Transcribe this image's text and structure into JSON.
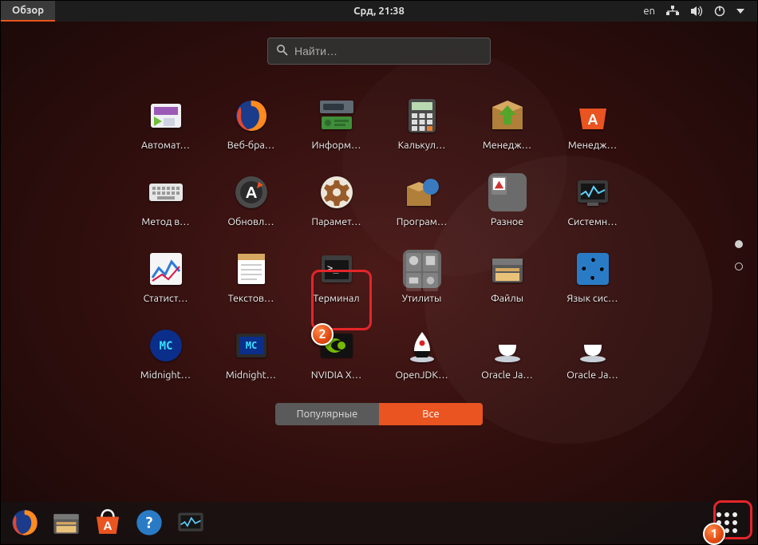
{
  "topbar": {
    "overview_label": "Обзор",
    "datetime": "Срд, 21:38",
    "lang": "en"
  },
  "search": {
    "placeholder": "Найти…"
  },
  "apps": [
    {
      "id": "automat",
      "label": "Автомат…"
    },
    {
      "id": "firefox",
      "label": "Веб-бра…"
    },
    {
      "id": "inform",
      "label": "Информ…"
    },
    {
      "id": "calc",
      "label": "Калькул…"
    },
    {
      "id": "mgr1",
      "label": "Менедж…"
    },
    {
      "id": "mgr2",
      "label": "Менедж…"
    },
    {
      "id": "input",
      "label": "Метод в…"
    },
    {
      "id": "updates",
      "label": "Обновл…"
    },
    {
      "id": "settings",
      "label": "Парамет…"
    },
    {
      "id": "programs",
      "label": "Програм…"
    },
    {
      "id": "misc",
      "label": "Разное",
      "folder": true
    },
    {
      "id": "sysmon",
      "label": "Системн…"
    },
    {
      "id": "stats",
      "label": "Статист…"
    },
    {
      "id": "textedit",
      "label": "Текстов…"
    },
    {
      "id": "terminal",
      "label": "Терминал"
    },
    {
      "id": "utils",
      "label": "Утилиты",
      "folder": true
    },
    {
      "id": "files",
      "label": "Файлы"
    },
    {
      "id": "locale",
      "label": "Язык сис…"
    },
    {
      "id": "mc1",
      "label": "Midnight…"
    },
    {
      "id": "mc2",
      "label": "Midnight…"
    },
    {
      "id": "nvidia",
      "label": "NVIDIA X…"
    },
    {
      "id": "openjdk",
      "label": "OpenJDK…"
    },
    {
      "id": "oracle1",
      "label": "Oracle Ja…"
    },
    {
      "id": "oracle2",
      "label": "Oracle Ja…"
    }
  ],
  "tabs": {
    "frequent": "Популярные",
    "all": "Все",
    "active": "all"
  },
  "pager": {
    "total": 2,
    "active": 0
  },
  "dock": [
    {
      "id": "firefox"
    },
    {
      "id": "files"
    },
    {
      "id": "software"
    },
    {
      "id": "help"
    },
    {
      "id": "sysmon"
    }
  ],
  "callouts": {
    "terminal": "2",
    "show_apps": "1"
  }
}
